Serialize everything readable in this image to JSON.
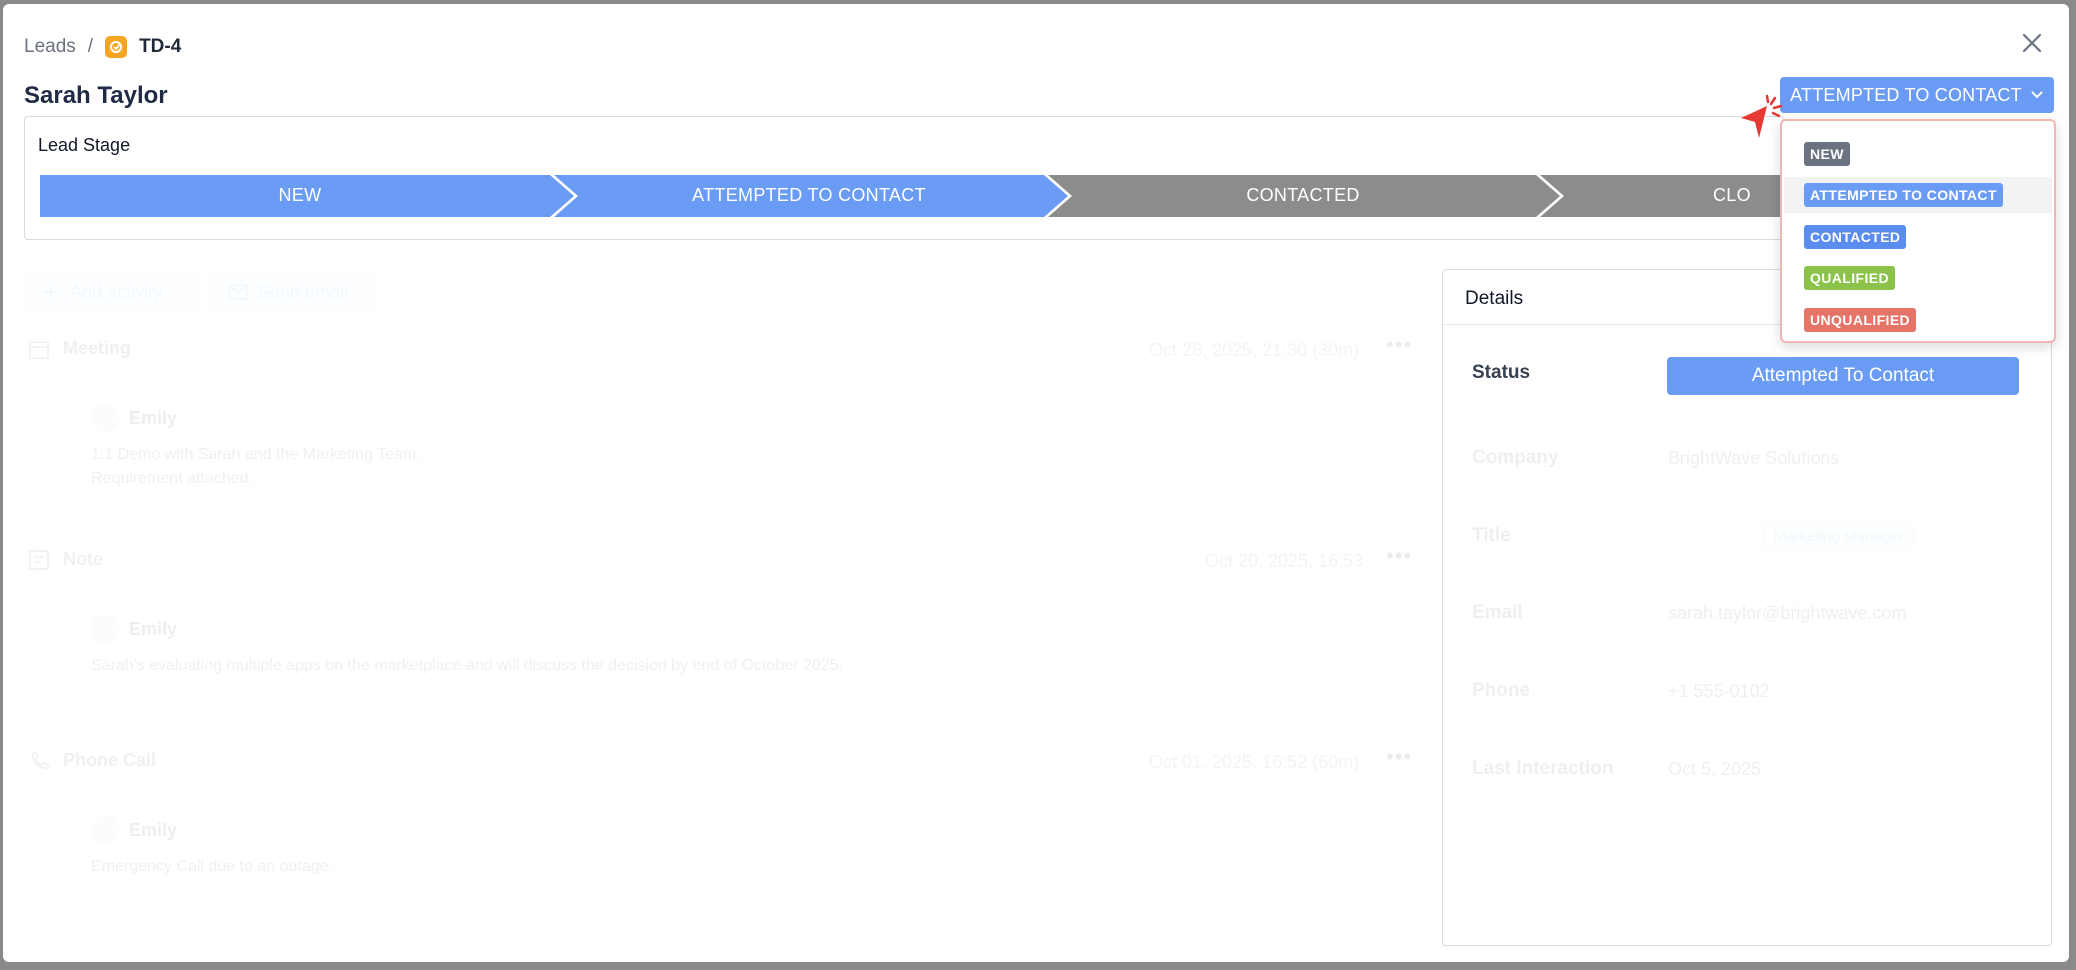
{
  "breadcrumb": {
    "root": "Leads",
    "separator": "/",
    "current": "TD-4"
  },
  "header": {
    "title": "Sarah Taylor",
    "status_button": "ATTEMPTED TO CONTACT"
  },
  "stage_card": {
    "label": "Lead Stage",
    "stages": [
      {
        "label": "NEW",
        "active": true
      },
      {
        "label": "ATTEMPTED TO CONTACT",
        "active": true
      },
      {
        "label": "CONTACTED",
        "active": false
      },
      {
        "label": "CLOSED",
        "visible_text": "CLO",
        "active": false
      }
    ]
  },
  "actions": {
    "add_activity": "Add activity",
    "send_email": "Send email"
  },
  "activities": [
    {
      "type": "Meeting",
      "time": "Oct 28, 2025, 21:30 (30m)",
      "author": "Emily",
      "lines": [
        "1:1 Demo with Sarah and the Marketing Team.",
        "Requirement attached."
      ]
    },
    {
      "type": "Note",
      "time": "Oct 20, 2025, 16:53",
      "author": "Emily",
      "lines": [
        "Sarah's evaluating multiple apps on the marketplace and will discuss the decision by end of October 2025."
      ]
    },
    {
      "type": "Phone Call",
      "time": "Oct 01, 2025, 16:52 (60m)",
      "author": "Emily",
      "lines": [
        "Emergency Call due to an outage."
      ]
    }
  ],
  "details": {
    "title": "Details",
    "status_label": "Status",
    "status_value": "Attempted To Contact",
    "company_label": "Company",
    "company_value": "BrightWave Solutions",
    "title_label": "Title",
    "title_value": "Marketing Manager",
    "email_label": "Email",
    "email_value": "sarah.taylor@brightwave.com",
    "phone_label": "Phone",
    "phone_value": "+1 555-0102",
    "last_label": "Last Interaction",
    "last_value": "Oct 5, 2025"
  },
  "dropdown": {
    "options": [
      {
        "label": "NEW",
        "color": "#6b7280"
      },
      {
        "label": "ATTEMPTED TO CONTACT",
        "color": "#6b9cf5",
        "selected": true
      },
      {
        "label": "CONTACTED",
        "color": "#5b8def"
      },
      {
        "label": "QUALIFIED",
        "color": "#8bc34a"
      },
      {
        "label": "UNQUALIFIED",
        "color": "#e57368"
      }
    ]
  },
  "colors": {
    "accent": "#6b9cf5",
    "inactive_stage": "#8c8c8c",
    "page_bg": "#8a8a8a"
  },
  "icons": [
    "close-icon",
    "chevron-down-icon",
    "plus-icon",
    "mail-icon",
    "calendar-icon",
    "note-icon",
    "phone-icon",
    "lead-type-icon",
    "cursor-icon"
  ]
}
